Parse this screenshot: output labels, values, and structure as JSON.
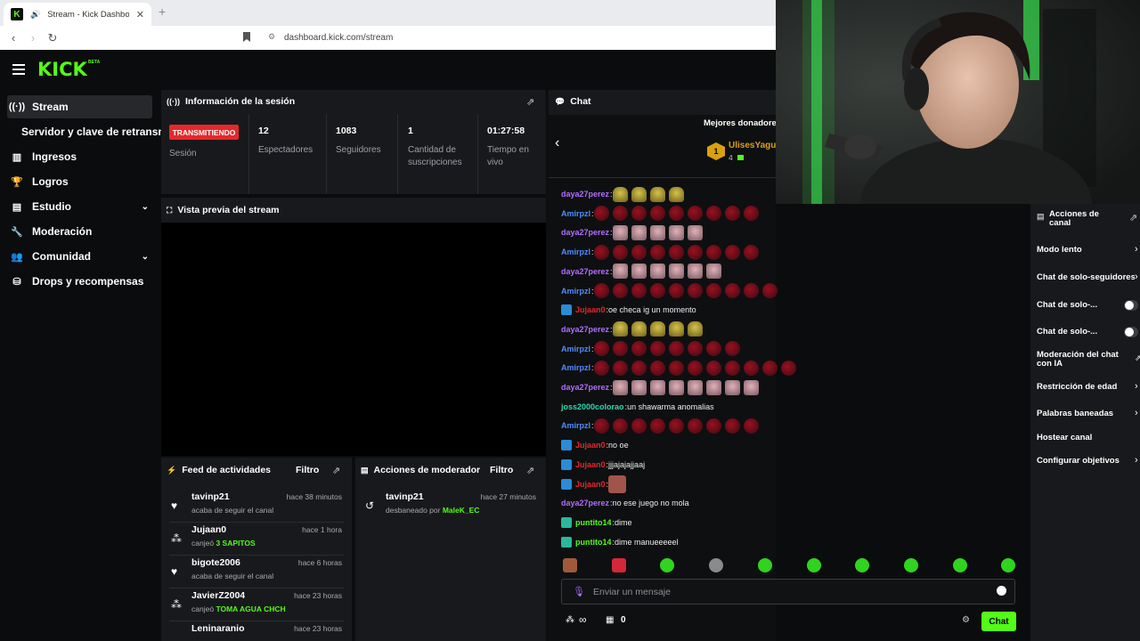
{
  "browser": {
    "tab_title": "Stream - Kick Dashboard",
    "url": "dashboard.kick.com/stream"
  },
  "brand": {
    "logo": "KICK",
    "beta": "BETA",
    "accent": "#53fc18"
  },
  "sidebar": {
    "items": [
      {
        "label": "Stream",
        "icon": "broadcast-icon",
        "active": true
      },
      {
        "label": "Servidor y clave de retransmisión",
        "icon": "",
        "active": false
      },
      {
        "label": "Ingresos",
        "icon": "chart-icon",
        "active": false
      },
      {
        "label": "Logros",
        "icon": "trophy-icon",
        "active": false
      },
      {
        "label": "Estudio",
        "icon": "studio-icon",
        "active": false,
        "expandable": true
      },
      {
        "label": "Moderación",
        "icon": "wrench-icon",
        "active": false
      },
      {
        "label": "Comunidad",
        "icon": "people-icon",
        "active": false,
        "expandable": true
      },
      {
        "label": "Drops y recompensas",
        "icon": "drops-icon",
        "active": false
      }
    ]
  },
  "session": {
    "title": "Información de la sesión",
    "status_badge": "TRANSMITIENDO",
    "status_label": "Sesión",
    "stats": [
      {
        "value": "12",
        "label": "Espectadores"
      },
      {
        "value": "1083",
        "label": "Seguidores"
      },
      {
        "value": "1",
        "label": "Cantidad de suscripciones"
      },
      {
        "value": "01:27:58",
        "label": "Tiempo en vivo"
      }
    ]
  },
  "preview": {
    "title": "Vista previa del stream"
  },
  "activity_feed": {
    "title": "Feed de actividades",
    "filter": "Filtro",
    "items": [
      {
        "name": "tavinp21",
        "time": "hace 38 minutos",
        "desc": "acaba de seguir el canal",
        "highlight": "",
        "icon": "heart-icon"
      },
      {
        "name": "Jujaan0",
        "time": "hace 1 hora",
        "desc": "canjeó",
        "highlight": "3 SAPITOS",
        "icon": "points-icon"
      },
      {
        "name": "bigote2006",
        "time": "hace 6 horas",
        "desc": "acaba de seguir el canal",
        "highlight": "",
        "icon": "heart-icon"
      },
      {
        "name": "JavierZ2004",
        "time": "hace 23 horas",
        "desc": "canjeó",
        "highlight": "TOMA AGUA CHCH",
        "icon": "points-icon"
      },
      {
        "name": "Leninaranio",
        "time": "hace 23 horas",
        "desc": "",
        "highlight": "",
        "icon": ""
      }
    ]
  },
  "mod_actions": {
    "title": "Acciones de moderador",
    "filter": "Filtro",
    "items": [
      {
        "name": "tavinp21",
        "time": "hace 27 minutos",
        "desc": "desbaneado por",
        "by": "MaleK_EC"
      }
    ]
  },
  "chat": {
    "title": "Chat",
    "top_donors_title": "Mejores donadores",
    "top_donor": {
      "rank": "1",
      "name": "UlisesYagu",
      "amount": "4"
    },
    "messages": [
      {
        "user": "daya27perez",
        "color": "#b16cff",
        "text": "",
        "emotes": [
          "yel",
          "yel",
          "yel",
          "yel"
        ],
        "badge": ""
      },
      {
        "user": "Amirpzl",
        "color": "#4f8cff",
        "text": "",
        "emotes": [
          "red",
          "red",
          "red",
          "red",
          "red",
          "red",
          "red",
          "red",
          "red"
        ],
        "badge": ""
      },
      {
        "user": "daya27perez",
        "color": "#b16cff",
        "text": "",
        "emotes": [
          "pink",
          "pink",
          "pink",
          "pink",
          "pink"
        ],
        "badge": ""
      },
      {
        "user": "Amirpzl",
        "color": "#4f8cff",
        "text": "",
        "emotes": [
          "red",
          "red",
          "red",
          "red",
          "red",
          "red",
          "red",
          "red",
          "red"
        ],
        "badge": ""
      },
      {
        "user": "daya27perez",
        "color": "#b16cff",
        "text": "",
        "emotes": [
          "pink",
          "pink",
          "pink",
          "pink",
          "pink",
          "pink"
        ],
        "badge": ""
      },
      {
        "user": "Amirpzl",
        "color": "#4f8cff",
        "text": "",
        "emotes": [
          "red",
          "red",
          "red",
          "red",
          "red",
          "red",
          "red",
          "red",
          "red",
          "red"
        ],
        "badge": ""
      },
      {
        "user": "Jujaan0",
        "color": "#e5282a",
        "text": "oe checa ig un momento",
        "emotes": [],
        "badge": "mod"
      },
      {
        "user": "daya27perez",
        "color": "#b16cff",
        "text": "",
        "emotes": [
          "yel",
          "yel",
          "yel",
          "yel",
          "yel"
        ],
        "badge": ""
      },
      {
        "user": "Amirpzl",
        "color": "#4f8cff",
        "text": "",
        "emotes": [
          "red",
          "red",
          "red",
          "red",
          "red",
          "red",
          "red",
          "red"
        ],
        "badge": ""
      },
      {
        "user": "Amirpzl",
        "color": "#4f8cff",
        "text": "",
        "emotes": [
          "red",
          "red",
          "red",
          "red",
          "red",
          "red",
          "red",
          "red",
          "red",
          "red",
          "red"
        ],
        "badge": ""
      },
      {
        "user": "daya27perez",
        "color": "#b16cff",
        "text": "",
        "emotes": [
          "pink",
          "pink",
          "pink",
          "pink",
          "pink",
          "pink",
          "pink",
          "pink"
        ],
        "badge": ""
      },
      {
        "user": "joss2000colorao",
        "color": "#2ad9b3",
        "text": "un shawarma anomalias",
        "emotes": [],
        "badge": ""
      },
      {
        "user": "Amirpzl",
        "color": "#4f8cff",
        "text": "",
        "emotes": [
          "red",
          "red",
          "red",
          "red",
          "red",
          "red",
          "red",
          "red",
          "red"
        ],
        "badge": ""
      },
      {
        "user": "Jujaan0",
        "color": "#e5282a",
        "text": "no oe",
        "emotes": [],
        "badge": "mod"
      },
      {
        "user": "Jujaan0",
        "color": "#e5282a",
        "text": "jjjajajajjaaj",
        "emotes": [],
        "badge": "mod"
      },
      {
        "user": "Jujaan0",
        "color": "#e5282a",
        "text": "",
        "emotes": [
          "face"
        ],
        "badge": "mod"
      },
      {
        "user": "daya27perez",
        "color": "#b16cff",
        "text": "no ese juego no mola",
        "emotes": [],
        "badge": ""
      },
      {
        "user": "puntito14",
        "color": "#53fc18",
        "text": "dime",
        "emotes": [],
        "badge": "tv"
      },
      {
        "user": "puntito14",
        "color": "#53fc18",
        "text": "dime manueeeeel",
        "emotes": [],
        "badge": "tv"
      }
    ],
    "input_placeholder": "Enviar un mensaje",
    "points": "∞",
    "points_other": "0",
    "send_label": "Chat"
  },
  "channel_actions": {
    "title": "Acciones de canal",
    "items": [
      {
        "label": "Modo lento",
        "control": "chevron"
      },
      {
        "label": "Chat de solo-seguidores",
        "control": "chevron"
      },
      {
        "label": "Chat de solo-...",
        "control": "toggle"
      },
      {
        "label": "Chat de solo-...",
        "control": "toggle"
      },
      {
        "label": "Moderación del chat con IA",
        "control": "external"
      },
      {
        "label": "Restricción de edad",
        "control": "chevron"
      },
      {
        "label": "Palabras baneadas",
        "control": "chevron"
      },
      {
        "label": "Hostear canal",
        "control": "none"
      },
      {
        "label": "Configurar objetivos",
        "control": "chevron"
      }
    ]
  }
}
